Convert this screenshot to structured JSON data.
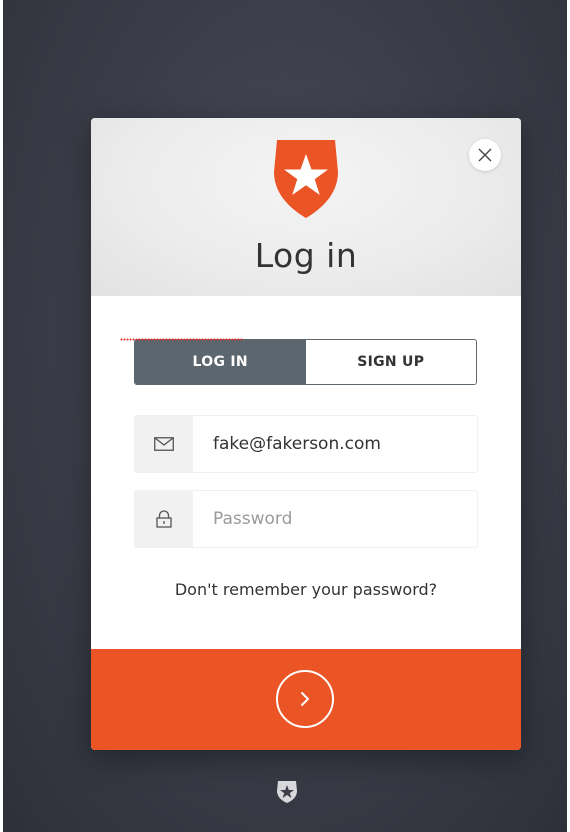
{
  "header": {
    "title": "Log in"
  },
  "tabs": [
    {
      "label": "LOG IN",
      "active": true
    },
    {
      "label": "SIGN UP",
      "active": false
    }
  ],
  "email": {
    "value": "fake@fakerson.com",
    "placeholder": "",
    "icon": "envelope-icon"
  },
  "password": {
    "value": "",
    "placeholder": "Password",
    "icon": "lock-icon"
  },
  "forgot_link": "Don't remember your password?",
  "submit": {
    "icon": "chevron-right-icon"
  },
  "colors": {
    "brand": "#eb5424",
    "tab_active": "#5c666f",
    "background": "#3c3e4a"
  }
}
